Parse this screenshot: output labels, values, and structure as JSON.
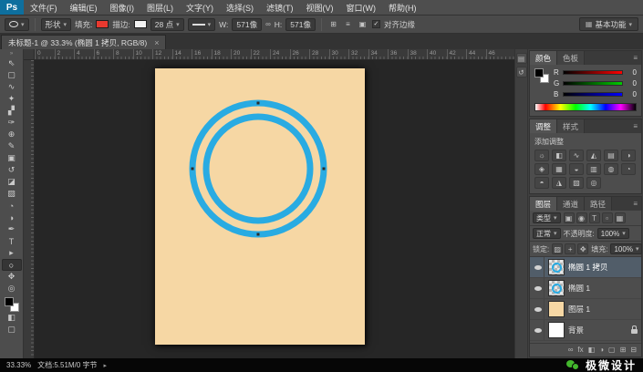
{
  "app": {
    "logo_text": "Ps",
    "workspace_button": "基本功能"
  },
  "menubar": {
    "items": [
      "文件(F)",
      "编辑(E)",
      "图像(I)",
      "图层(L)",
      "文字(Y)",
      "选择(S)",
      "滤镜(T)",
      "视图(V)",
      "窗口(W)",
      "帮助(H)"
    ]
  },
  "options_bar": {
    "tool_mode_value": "形状",
    "fill_label": "填充:",
    "stroke_label": "描边:",
    "stroke_width_value": "28 点",
    "w_label": "W:",
    "w_value": "571像",
    "h_label": "H:",
    "h_value": "571像",
    "op_icons": [
      "⊞",
      "≡",
      "▣"
    ],
    "align_edges_label": "对齐边缘"
  },
  "document_tab": {
    "title": "未标题-1 @ 33.3% (椭圆 1 拷贝, RGB/8)",
    "close_glyph": "×"
  },
  "toolbar": {
    "tools": [
      {
        "name": "move-tool",
        "glyph": "⇖"
      },
      {
        "name": "marquee-tool",
        "glyph": "▢"
      },
      {
        "name": "lasso-tool",
        "glyph": "∿"
      },
      {
        "name": "quick-selection-tool",
        "glyph": "✦"
      },
      {
        "name": "crop-tool",
        "glyph": "▞"
      },
      {
        "name": "eyedropper-tool",
        "glyph": "✑"
      },
      {
        "name": "healing-brush-tool",
        "glyph": "⊕"
      },
      {
        "name": "brush-tool",
        "glyph": "✎"
      },
      {
        "name": "clone-stamp-tool",
        "glyph": "▣"
      },
      {
        "name": "history-brush-tool",
        "glyph": "↺"
      },
      {
        "name": "eraser-tool",
        "glyph": "◪"
      },
      {
        "name": "gradient-tool",
        "glyph": "▨"
      },
      {
        "name": "blur-tool",
        "glyph": "◔"
      },
      {
        "name": "dodge-tool",
        "glyph": "◑"
      },
      {
        "name": "pen-tool",
        "glyph": "✒"
      },
      {
        "name": "type-tool",
        "glyph": "T"
      },
      {
        "name": "path-selection-tool",
        "glyph": "▸"
      },
      {
        "name": "ellipse-shape-tool",
        "glyph": "○",
        "active": true
      },
      {
        "name": "hand-tool",
        "glyph": "✥"
      },
      {
        "name": "zoom-tool",
        "glyph": "◎"
      }
    ]
  },
  "ruler": {
    "numbers": [
      "0",
      "2",
      "4",
      "6",
      "8",
      "10",
      "12",
      "14",
      "16",
      "18",
      "20",
      "22",
      "24",
      "26",
      "28",
      "30",
      "32",
      "34",
      "36",
      "38",
      "40",
      "42",
      "44",
      "46"
    ]
  },
  "dock": {
    "icons": [
      "▤",
      "↺"
    ]
  },
  "color_panel": {
    "tabs": [
      {
        "label": "颜色",
        "active": true
      },
      {
        "label": "色板"
      }
    ],
    "channels": [
      {
        "label": "R",
        "value": "0",
        "chan": "r"
      },
      {
        "label": "G",
        "value": "0",
        "chan": "g"
      },
      {
        "label": "B",
        "value": "0",
        "chan": "b"
      }
    ]
  },
  "adjustments_panel": {
    "tabs": [
      {
        "label": "调整",
        "active": true
      },
      {
        "label": "样式"
      }
    ],
    "add_label": "添加调整",
    "icons": [
      "☼",
      "◧",
      "∿",
      "◭",
      "▤",
      "◑",
      "◈",
      "▦",
      "◒",
      "▥",
      "◍",
      "◔",
      "◓",
      "◮",
      "▨",
      "◎"
    ]
  },
  "layers_panel": {
    "tabs": [
      {
        "label": "图层",
        "active": true
      },
      {
        "label": "通道"
      },
      {
        "label": "路径"
      }
    ],
    "filter_label": "类型",
    "filter_icons": [
      "▣",
      "◉",
      "T",
      "▫",
      "▦"
    ],
    "blend_mode_value": "正常",
    "opacity_label": "不透明度:",
    "opacity_value": "100%",
    "lock_label": "锁定:",
    "lock_icons": [
      "▨",
      "+",
      "✥"
    ],
    "fill_label": "填充:",
    "fill_value": "100%",
    "layers": [
      {
        "name": "椭圆 1 拷贝",
        "selected": true,
        "thumb": "ring"
      },
      {
        "name": "椭圆 1",
        "thumb": "ring"
      },
      {
        "name": "图层 1",
        "thumb": "tan"
      },
      {
        "name": "背景",
        "thumb": "white",
        "locked": true
      }
    ],
    "bottom_icons": [
      "∞",
      "fx",
      "◧",
      "◑",
      "▢",
      "⊞",
      "⊟"
    ]
  },
  "status_bar": {
    "zoom": "33.33%",
    "doc_info": "文档:5.51M/0 字节"
  },
  "watermark": {
    "text": "极微设计"
  },
  "icons": {
    "dropdown": "▾",
    "panel_menu": "≡",
    "check": "✓",
    "link": "∞",
    "status_arrow": "▸",
    "workspace": "▦",
    "toolbar_collapse": "»"
  },
  "colors": {
    "accent_blue": "#29abe2",
    "doc_fill": "#f6d7a4",
    "fill_swatch": "#e8392f",
    "stroke_swatch": "#f2f2f2"
  }
}
